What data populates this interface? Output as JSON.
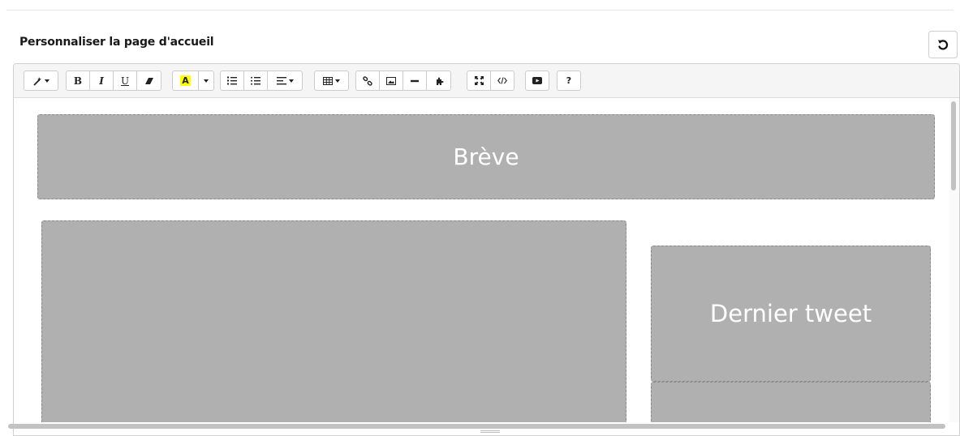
{
  "page": {
    "heading": "Personnaliser la page d'accueil",
    "reset_icon": "rotate-ccw-icon"
  },
  "toolbar": {
    "style_icon": "magic-wand-icon",
    "bold": "B",
    "italic": "I",
    "underline": "U",
    "eraser_icon": "eraser-icon",
    "color_letter": "A",
    "color_highlight": "#ffff00",
    "ordered_list_icon": "ordered-list-icon",
    "unordered_list_icon": "unordered-list-icon",
    "align_icon": "align-left-icon",
    "table_icon": "table-icon",
    "link_icon": "link-icon",
    "image_icon": "image-icon",
    "hr_icon": "horizontal-rule-icon",
    "plugin_icon": "puzzle-icon",
    "fullscreen_icon": "fullscreen-icon",
    "code_icon": "code-view-icon",
    "video_icon": "video-icon",
    "help": "?"
  },
  "blocks": {
    "breve": "Brève",
    "dernier_tweet": "Dernier tweet",
    "color": "#b0b0b0"
  }
}
